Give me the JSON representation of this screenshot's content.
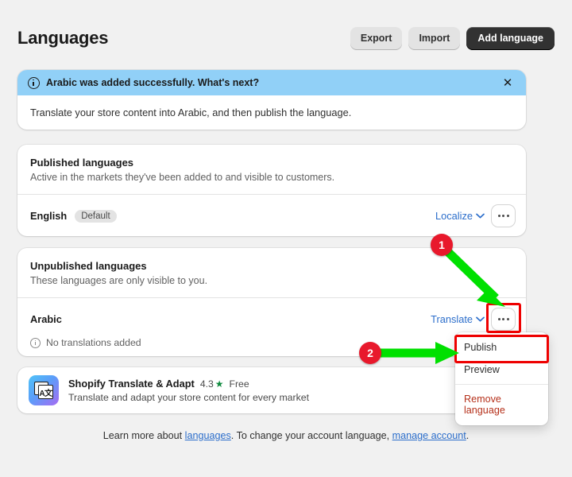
{
  "header": {
    "title": "Languages",
    "buttons": [
      {
        "label": "Export",
        "style": "secondary"
      },
      {
        "label": "Import",
        "style": "secondary"
      },
      {
        "label": "Add language",
        "style": "primary"
      }
    ]
  },
  "banner": {
    "icon": "info-circle-icon",
    "title": "Arabic was added successfully. What's next?",
    "body": "Translate your store content into Arabic, and then publish the language.",
    "close_icon": "close-icon",
    "background": "#91d0f7"
  },
  "published": {
    "title": "Published languages",
    "subtitle": "Active in the markets they've been added to and visible to customers.",
    "row": {
      "name": "English",
      "badge": "Default",
      "action_label": "Localize",
      "chevron_icon": "chevron-down-icon",
      "kebab_icon": "kebab-menu-icon"
    }
  },
  "unpublished": {
    "title": "Unpublished languages",
    "subtitle": "These languages are only visible to you.",
    "row": {
      "name": "Arabic",
      "action_label": "Translate",
      "chevron_icon": "chevron-down-icon",
      "kebab_icon": "kebab-menu-icon",
      "note_icon": "info-circle-icon",
      "note": "No translations added"
    }
  },
  "menu": {
    "items": [
      {
        "label": "Publish",
        "danger": false
      },
      {
        "label": "Preview",
        "danger": false
      },
      {
        "label": "Remove language",
        "danger": true
      }
    ]
  },
  "app": {
    "icon": "translate-app-icon",
    "name": "Shopify Translate & Adapt",
    "rating": "4.3",
    "star_icon": "star-icon",
    "price": "Free",
    "description": "Translate and adapt your store content for every market"
  },
  "footer": {
    "text_before": "Learn more about ",
    "link1": "languages",
    "text_middle": ". To change your account language, ",
    "link2": "manage account",
    "text_after": "."
  },
  "annotations": {
    "marker1": "1",
    "marker2": "2",
    "highlight_color": "#ee0000",
    "arrow_color": "#00e000",
    "marker_color": "#e8192c"
  }
}
